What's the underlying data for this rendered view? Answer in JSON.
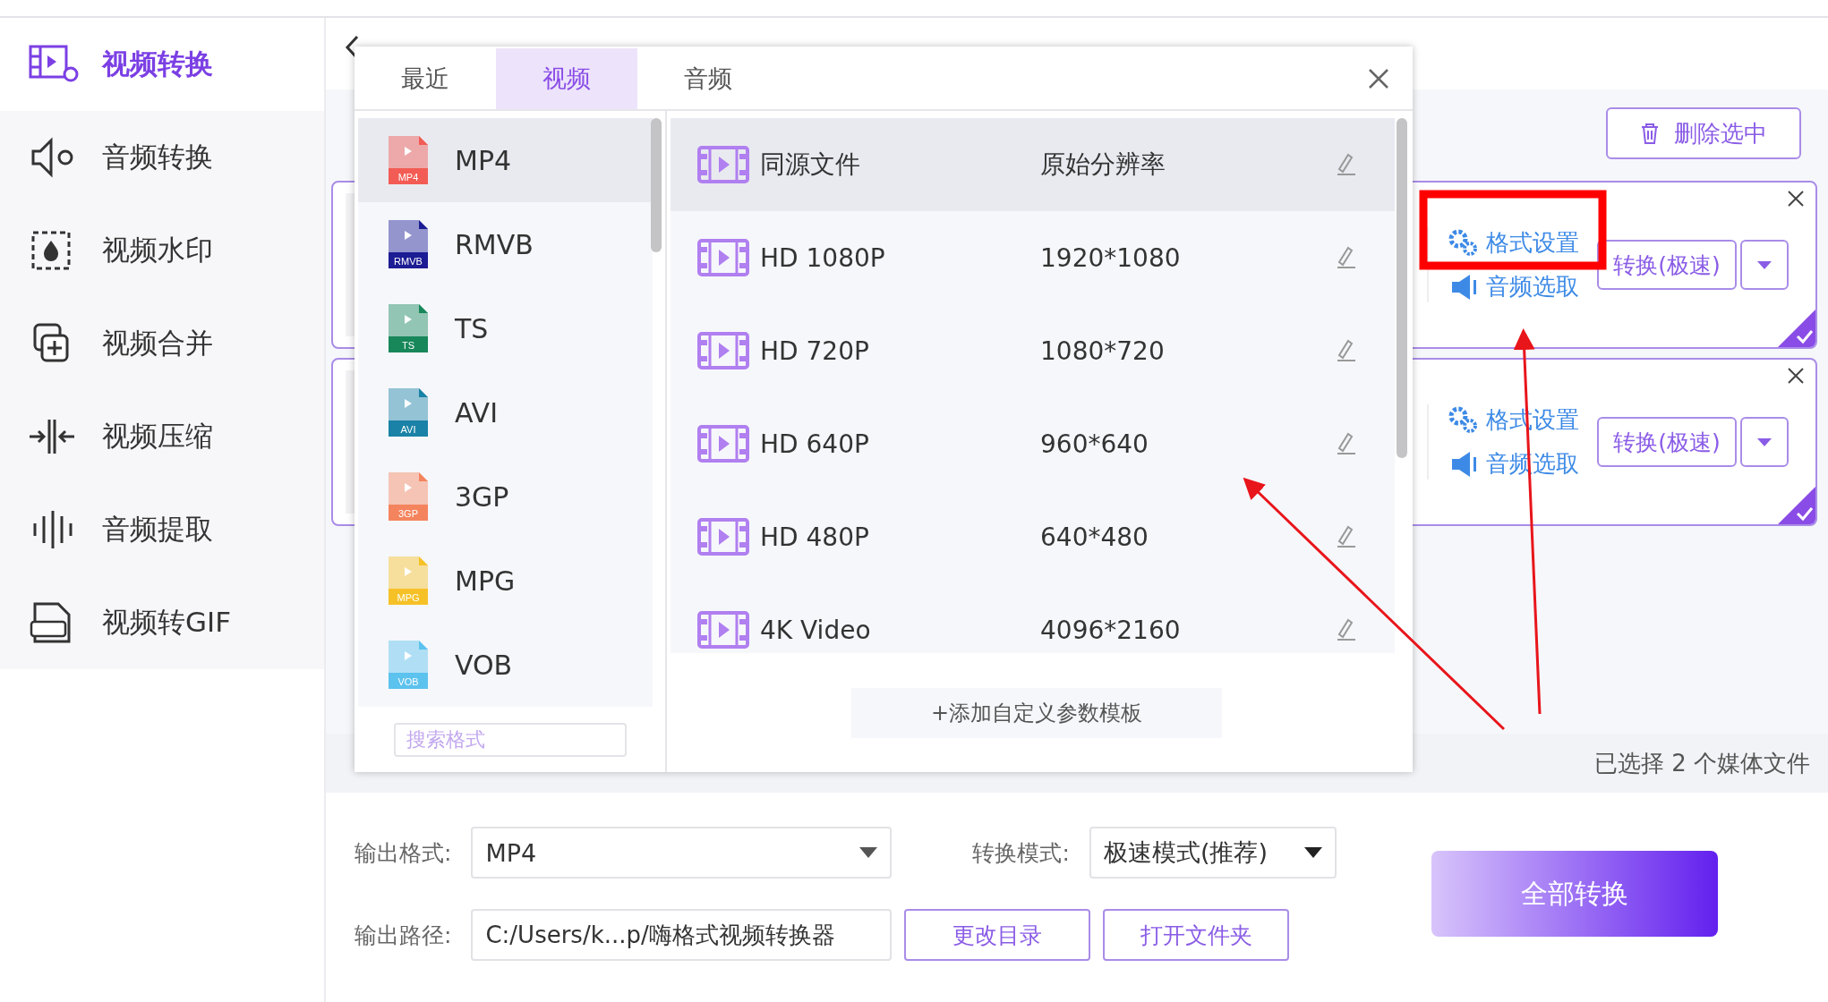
{
  "sidebar": {
    "items": [
      {
        "label": "视频转换",
        "selected": true
      },
      {
        "label": "音频转换",
        "selected": false
      },
      {
        "label": "视频水印",
        "selected": false
      },
      {
        "label": "视频合并",
        "selected": false
      },
      {
        "label": "视频压缩",
        "selected": false
      },
      {
        "label": "音频提取",
        "selected": false
      },
      {
        "label": "视频转GIF",
        "selected": false
      }
    ]
  },
  "toolbar": {
    "delete_button": "删除选中"
  },
  "files": [
    {
      "format_settings": "格式设置",
      "audio_select": "音频选取",
      "convert_button": "转换(极速)",
      "selected": true
    },
    {
      "format_settings": "格式设置",
      "audio_select": "音频选取",
      "convert_button": "转换(极速)",
      "selected": true
    }
  ],
  "selection_summary": "已选择 2 个媒体文件",
  "output": {
    "format_label": "输出格式:",
    "format_value": "MP4",
    "mode_label": "转换模式:",
    "mode_value": "极速模式(推荐)",
    "path_label": "输出路径:",
    "path_value": "C:/Users/k...p/嗨格式视频转换器",
    "change_dir_button": "更改目录",
    "open_folder_button": "打开文件夹",
    "convert_all_button": "全部转换"
  },
  "format_dialog": {
    "tabs": [
      {
        "label": "最近",
        "selected": false
      },
      {
        "label": "视频",
        "selected": true
      },
      {
        "label": "音频",
        "selected": false
      }
    ],
    "formats": [
      {
        "label": "MP4",
        "badge": "MP4",
        "color": "#f25c54",
        "selected": true
      },
      {
        "label": "RMVB",
        "badge": "RMVB",
        "color": "#1c1c94",
        "selected": false
      },
      {
        "label": "TS",
        "badge": "TS",
        "color": "#18875a",
        "selected": false
      },
      {
        "label": "AVI",
        "badge": "AVI",
        "color": "#1a82a6",
        "selected": false
      },
      {
        "label": "3GP",
        "badge": "3GP",
        "color": "#f4845e",
        "selected": false
      },
      {
        "label": "MPG",
        "badge": "MPG",
        "color": "#f6c127",
        "selected": false
      },
      {
        "label": "VOB",
        "badge": "VOB",
        "color": "#5cc2ee",
        "selected": false
      }
    ],
    "search": {
      "placeholder": "搜索格式"
    },
    "presets": [
      {
        "name": "同源文件",
        "resolution": "原始分辨率",
        "selected": true
      },
      {
        "name": "HD 1080P",
        "resolution": "1920*1080",
        "selected": false
      },
      {
        "name": "HD 720P",
        "resolution": "1080*720",
        "selected": false
      },
      {
        "name": "HD 640P",
        "resolution": "960*640",
        "selected": false
      },
      {
        "name": "HD 480P",
        "resolution": "640*480",
        "selected": false
      },
      {
        "name": "4K Video",
        "resolution": "4096*2160",
        "selected": false
      }
    ],
    "add_template_button": "+添加自定义参数模板"
  }
}
